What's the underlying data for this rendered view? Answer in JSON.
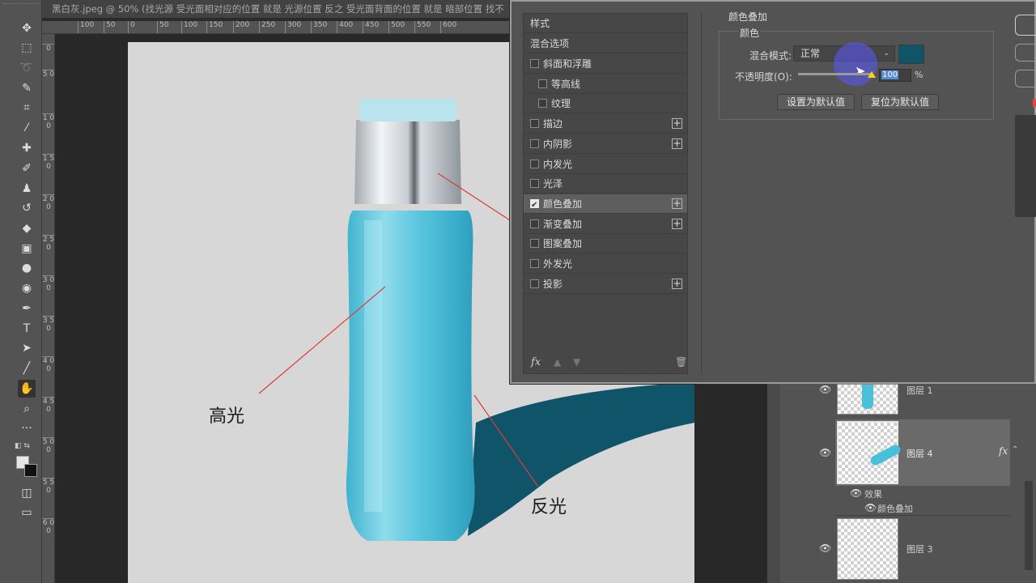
{
  "window": {
    "title": "黑白灰.jpeg @ 50% (找光源 受光面相对应的位置 就是 光源位置 反之 受光面背面的位置 就是 暗部位置 找不"
  },
  "ruler": {
    "top_ticks": [
      "100",
      "50",
      "0",
      "50",
      "100",
      "150",
      "200",
      "250",
      "300",
      "350",
      "400",
      "450",
      "500",
      "550",
      "600"
    ],
    "left_ticks": [
      "0",
      "5 0",
      "1 0 0",
      "1 5 0",
      "2 0 0",
      "2 5 0",
      "3 0 0",
      "3 5 0",
      "4 0 0",
      "4 5 0",
      "5 0 0",
      "5 5 0",
      "6 0 0"
    ]
  },
  "canvas": {
    "highlight_label": "高光",
    "reflect_label": "反光",
    "colors": {
      "bottle": "#49c0da",
      "shadow_band": "#0f5468",
      "cap": "#c9ced4",
      "page": "#d7d7d7"
    }
  },
  "dialog": {
    "list_header": "样式",
    "blend_options": "混合选项",
    "items": [
      {
        "label": "斜面和浮雕",
        "checked": false,
        "plus": false,
        "indent": false
      },
      {
        "label": "等高线",
        "checked": false,
        "plus": false,
        "indent": true
      },
      {
        "label": "纹理",
        "checked": false,
        "plus": false,
        "indent": true
      },
      {
        "label": "描边",
        "checked": false,
        "plus": true,
        "indent": false
      },
      {
        "label": "内阴影",
        "checked": false,
        "plus": true,
        "indent": false
      },
      {
        "label": "内发光",
        "checked": false,
        "plus": false,
        "indent": false
      },
      {
        "label": "光泽",
        "checked": false,
        "plus": false,
        "indent": false
      },
      {
        "label": "颜色叠加",
        "checked": true,
        "plus": true,
        "indent": false
      },
      {
        "label": "渐变叠加",
        "checked": false,
        "plus": true,
        "indent": false
      },
      {
        "label": "图案叠加",
        "checked": false,
        "plus": false,
        "indent": false
      },
      {
        "label": "外发光",
        "checked": false,
        "plus": false,
        "indent": false
      },
      {
        "label": "投影",
        "checked": false,
        "plus": true,
        "indent": false
      }
    ],
    "footer_fx": "fx",
    "section_title": "颜色叠加",
    "group_title": "颜色",
    "blend_mode_label": "混合模式:",
    "blend_mode_value": "正常",
    "swatch_color": "#0f5468",
    "opacity_label": "不透明度(O):",
    "opacity_value": "100",
    "opacity_unit": "%",
    "opacity_level": 100,
    "set_default": "设置为默认值",
    "reset_default": "复位为默认值"
  },
  "layers": {
    "rows": [
      {
        "name": "图层 1"
      },
      {
        "name": "图层 4",
        "fx": "fx"
      },
      {
        "name": "图层 3"
      }
    ],
    "effects_label": "效果",
    "effect_item": "颜色叠加"
  }
}
